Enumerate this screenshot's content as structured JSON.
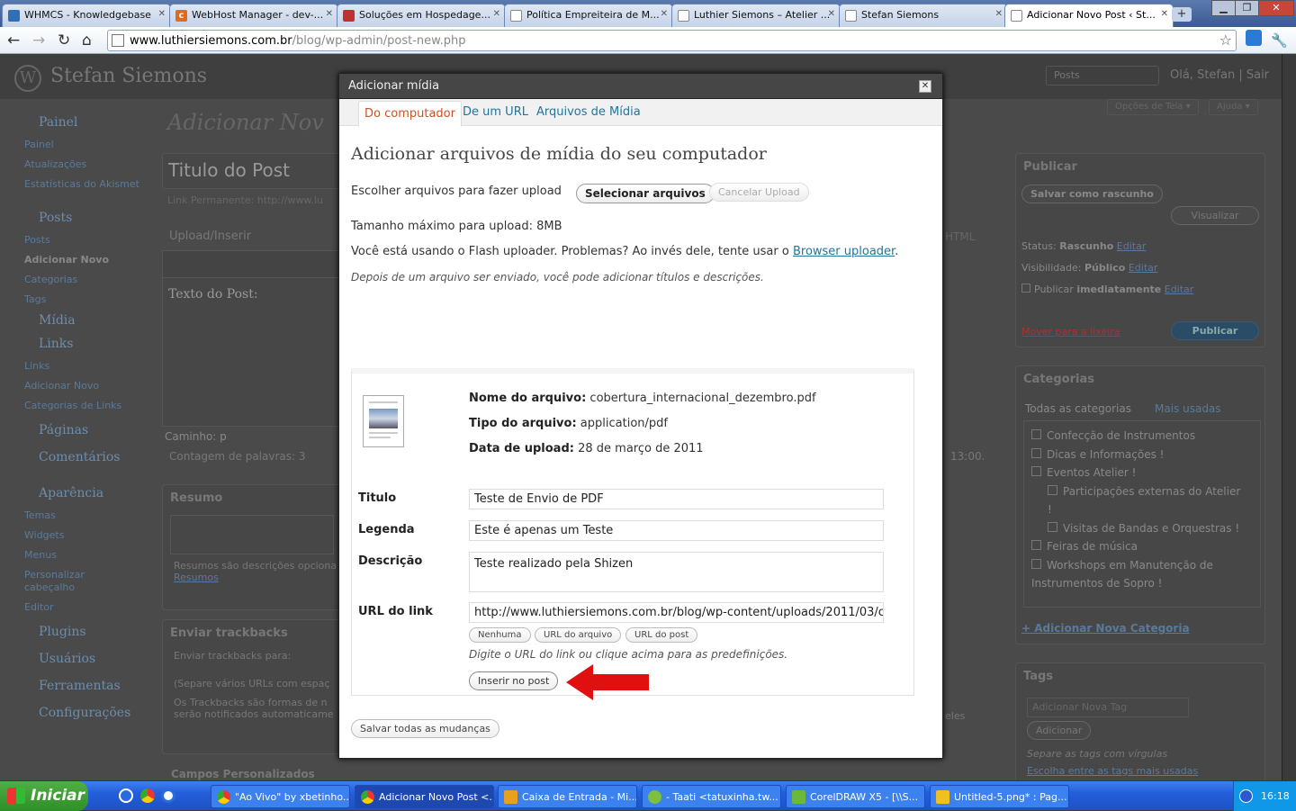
{
  "browser": {
    "tabs": [
      {
        "label": "WHMCS - Knowledgebase",
        "color": "#2f6fb5"
      },
      {
        "label": "WebHost Manager - dev-...",
        "color": "#e06b1f"
      },
      {
        "label": "Soluções em Hospedage...",
        "color": "#c03030"
      },
      {
        "label": "Política Empreiteira de M...",
        "color": "#ffffff"
      },
      {
        "label": "Luthier Siemons – Atelier ...",
        "color": "#ffffff"
      },
      {
        "label": "Stefan Siemons",
        "color": "#ffffff"
      },
      {
        "label": "Adicionar Novo Post ‹ St...",
        "color": "#ffffff"
      }
    ],
    "new_tab": "+",
    "url_host": "www.luthiersiemons.com.br",
    "url_path": "/blog/wp-admin/post-new.php"
  },
  "wp": {
    "site_name": "Stefan Siemons",
    "header_select": "Posts",
    "greeting": "Olá, Stefan | Sair",
    "screen_options": "Opções de Tela ▾",
    "help": "Ajuda ▾",
    "page_title": "Adicionar Nov",
    "post_title": "Titulo do Post",
    "permalink": "Link Permanente: http://www.lu",
    "upload_insert": "Upload/Inserir",
    "html_tab": "HTML",
    "post_text": "Texto do Post:",
    "path": "Caminho: p",
    "word_count": "Contagem de palavras: 3",
    "time": "13:00.",
    "menu": [
      {
        "top": "Painel",
        "subs": [
          "Painel",
          "Atualizações",
          "Estatísticas do Akismet"
        ]
      },
      {
        "top": "Posts",
        "subs": [
          "Posts",
          "Adicionar Novo",
          "Categorias",
          "Tags"
        ]
      },
      {
        "top": "Mídia",
        "subs": []
      },
      {
        "top": "Links",
        "subs": [
          "Links",
          "Adicionar Novo",
          "Categorias de Links"
        ]
      },
      {
        "top": "Páginas",
        "subs": []
      },
      {
        "top": "Comentários",
        "subs": []
      },
      {
        "top": "Aparência",
        "subs": [
          "Temas",
          "Widgets",
          "Menus",
          "Personalizar cabeçalho",
          "Editor"
        ]
      },
      {
        "top": "Plugins",
        "subs": []
      },
      {
        "top": "Usuários",
        "subs": []
      },
      {
        "top": "Ferramentas",
        "subs": []
      },
      {
        "top": "Configurações",
        "subs": []
      }
    ],
    "resumo_title": "Resumo",
    "resumo_note": "Resumos são descrições opciona",
    "resumo_link": "Resumos",
    "trackbacks_title": "Enviar trackbacks",
    "trackbacks_for": "Enviar trackbacks para:",
    "trackbacks_sep": "(Separe vários URLs com espaç",
    "trackbacks_info": "Os Trackbacks são formas de n",
    "trackbacks_info2": "serão notificados automaticame",
    "trackbacks_tail": "eles",
    "custom_fields": "Campos Personalizados",
    "publish": {
      "title": "Publicar",
      "save_draft": "Salvar como rascunho",
      "preview": "Visualizar",
      "status_label": "Status:",
      "status": "Rascunho",
      "visibility_label": "Visibilidade:",
      "visibility": "Público",
      "publish_label": "Publicar",
      "publish_when": "imediatamente",
      "edit": "Editar",
      "trash": "Mover para a lixeira",
      "publish_btn": "Publicar"
    },
    "categories": {
      "title": "Categorias",
      "tab_all": "Todas as categorias",
      "tab_most": "Mais usadas",
      "items": [
        "Confecção de Instrumentos",
        "Dicas e Informações !",
        "Eventos Atelier !",
        "Participações externas do Atelier !",
        "Visitas de Bandas e Orquestras !",
        "Feiras de música",
        "Workshops em Manutenção de Instrumentos de Sopro !"
      ],
      "add": "+ Adicionar Nova Categoria"
    },
    "tags": {
      "title": "Tags",
      "placeholder": "Adicionar Nova Tag",
      "add_btn": "Adicionar",
      "sep": "Separe as tags com vírgulas",
      "choose": "Escolha entre as tags mais usadas"
    }
  },
  "modal": {
    "title": "Adicionar mídia",
    "tabs": [
      "Do computador",
      "De um URL",
      "Arquivos de Mídia"
    ],
    "heading": "Adicionar arquivos de mídia do seu computador",
    "choose_label": "Escolher arquivos para fazer upload",
    "select_btn": "Selecionar arquivos",
    "cancel_btn": "Cancelar Upload",
    "max_size": "Tamanho máximo para upload: 8MB",
    "flash_note": "Você está usando o Flash uploader. Problemas? Ao invés dele, tente usar o",
    "browser_uploader": "Browser uploader",
    "after_upload": "Depois de um arquivo ser enviado, você pode adicionar títulos e descrições.",
    "file": {
      "name_label": "Nome do arquivo:",
      "name": "cobertura_internacional_dezembro.pdf",
      "type_label": "Tipo do arquivo:",
      "type": "application/pdf",
      "date_label": "Data de upload:",
      "date": "28 de março de 2011"
    },
    "fields": {
      "title_label": "Titulo",
      "title": "Teste de Envio de PDF",
      "caption_label": "Legenda",
      "caption": "Este é apenas um Teste",
      "desc_label": "Descrição",
      "desc": "Teste realizado pela Shizen",
      "url_label": "URL do link",
      "url": "http://www.luthiersiemons.com.br/blog/wp-content/uploads/2011/03/co"
    },
    "url_btns": [
      "Nenhuma",
      "URL do arquivo",
      "URL do post"
    ],
    "url_hint": "Digite o URL do link ou clique acima para as predefinições.",
    "insert_btn": "Inserir no post",
    "save_all": "Salvar todas as mudanças"
  },
  "taskbar": {
    "start": "Iniciar",
    "items": [
      {
        "label": "\"Ao Vivo\" by xbetinho...",
        "color": "#f2b90c"
      },
      {
        "label": "Adicionar Novo Post <...",
        "color": "#f2b90c"
      },
      {
        "label": "Caixa de Entrada - Mi...",
        "color": "#e8a020"
      },
      {
        "label": "- Taati <tatuxinha.tw...",
        "color": "#7ec03c"
      },
      {
        "label": "CorelDRAW X5 - [\\\\S...",
        "color": "#6cb83a"
      },
      {
        "label": "Untitled-5.png* : Pag...",
        "color": "#f0c020"
      }
    ],
    "clock": "16:18"
  },
  "accent": "#21759b",
  "arrow_color": "#e01010"
}
